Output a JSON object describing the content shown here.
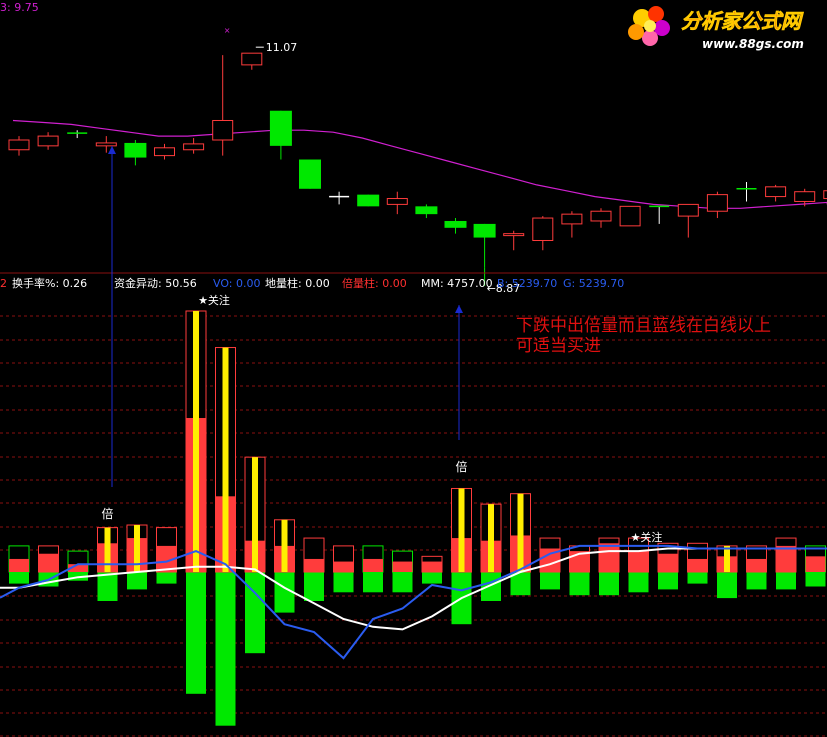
{
  "colors": {
    "background": "#000000",
    "up": "#ff3c3c",
    "down": "#00e800",
    "ma_line": "#d020d0",
    "grid": "#8a1010",
    "blue_line": "#2a5cf0",
    "white_line": "#ffffff",
    "highlight": "#ffee00",
    "annotation": "#e01010",
    "arrow": "#1a2ad0"
  },
  "header": {
    "price_top_label": "3: 9.75"
  },
  "logo": {
    "brand_cn": "分析家公式网",
    "url": "www.88gs.com"
  },
  "indicator_bar": {
    "index_label": "2",
    "items": [
      {
        "label": "换手率%:",
        "value": "0.26",
        "color": "#ffffff"
      },
      {
        "label": "资金异动:",
        "value": "50.56",
        "color": "#ffffff"
      },
      {
        "label": "VO:",
        "value": "0.00",
        "color": "#2a5cf0"
      },
      {
        "label": "地量柱:",
        "value": "0.00",
        "color": "#ffffff"
      },
      {
        "label": "倍量柱:",
        "value": "0.00",
        "color": "#ff3030"
      },
      {
        "label": "MM:",
        "value": "4757.00",
        "color": "#ffffff"
      },
      {
        "label": "B:",
        "value": "5239.70",
        "color": "#2a5cf0"
      },
      {
        "label": "G:",
        "value": "5239.70",
        "color": "#2a5cf0"
      }
    ]
  },
  "annotation": {
    "line1": "下跌中出倍量而且蓝线在白线以上",
    "line2": "可适当买进"
  },
  "markers": {
    "double_volume": "倍",
    "attention": "关注",
    "star": "★"
  },
  "chart_data": [
    {
      "type": "candlestick",
      "title": "",
      "annotations": [
        {
          "text": "11.07",
          "type": "high"
        },
        {
          "text": "8.87",
          "type": "low"
        }
      ],
      "ylim": [
        8.6,
        11.3
      ],
      "candles": [
        {
          "o": 10.08,
          "c": 10.18,
          "h": 10.22,
          "l": 10.02
        },
        {
          "o": 10.12,
          "c": 10.22,
          "h": 10.26,
          "l": 10.08
        },
        {
          "o": 10.25,
          "c": 10.25,
          "h": 10.28,
          "l": 10.2
        },
        {
          "o": 10.12,
          "c": 10.15,
          "h": 10.22,
          "l": 10.05
        },
        {
          "o": 10.15,
          "c": 10.0,
          "h": 10.18,
          "l": 9.92
        },
        {
          "o": 10.02,
          "c": 10.1,
          "h": 10.14,
          "l": 9.98
        },
        {
          "o": 10.08,
          "c": 10.14,
          "h": 10.2,
          "l": 10.04
        },
        {
          "o": 10.18,
          "c": 10.38,
          "h": 11.05,
          "l": 10.02
        },
        {
          "o": 10.95,
          "c": 11.07,
          "h": 11.07,
          "l": 10.9
        },
        {
          "o": 10.48,
          "c": 10.12,
          "h": 10.48,
          "l": 9.98
        },
        {
          "o": 9.98,
          "c": 9.68,
          "h": 9.98,
          "l": 9.68
        },
        {
          "o": 9.6,
          "c": 9.6,
          "h": 9.65,
          "l": 9.52
        },
        {
          "o": 9.62,
          "c": 9.5,
          "h": 9.62,
          "l": 9.5
        },
        {
          "o": 9.52,
          "c": 9.58,
          "h": 9.65,
          "l": 9.42
        },
        {
          "o": 9.5,
          "c": 9.42,
          "h": 9.52,
          "l": 9.38
        },
        {
          "o": 9.35,
          "c": 9.28,
          "h": 9.38,
          "l": 9.22
        },
        {
          "o": 9.32,
          "c": 9.18,
          "h": 9.32,
          "l": 8.87
        },
        {
          "o": 9.2,
          "c": 9.22,
          "h": 9.25,
          "l": 9.05
        },
        {
          "o": 9.15,
          "c": 9.38,
          "h": 9.4,
          "l": 9.05
        },
        {
          "o": 9.32,
          "c": 9.42,
          "h": 9.45,
          "l": 9.18
        },
        {
          "o": 9.35,
          "c": 9.45,
          "h": 9.48,
          "l": 9.28
        },
        {
          "o": 9.3,
          "c": 9.5,
          "h": 9.5,
          "l": 9.3
        },
        {
          "o": 9.5,
          "c": 9.5,
          "h": 9.5,
          "l": 9.32
        },
        {
          "o": 9.4,
          "c": 9.52,
          "h": 9.52,
          "l": 9.18
        },
        {
          "o": 9.45,
          "c": 9.62,
          "h": 9.65,
          "l": 9.38
        },
        {
          "o": 9.68,
          "c": 9.68,
          "h": 9.75,
          "l": 9.55
        },
        {
          "o": 9.6,
          "c": 9.7,
          "h": 9.72,
          "l": 9.55
        },
        {
          "o": 9.55,
          "c": 9.65,
          "h": 9.68,
          "l": 9.5
        },
        {
          "o": 9.58,
          "c": 9.66,
          "h": 9.7,
          "l": 9.55
        }
      ],
      "ma": [
        10.38,
        10.36,
        10.34,
        10.3,
        10.26,
        10.22,
        10.22,
        10.24,
        10.26,
        10.28,
        10.28,
        10.26,
        10.2,
        10.12,
        10.04,
        9.96,
        9.88,
        9.8,
        9.72,
        9.66,
        9.6,
        9.56,
        9.52,
        9.5,
        9.48,
        9.48,
        9.5,
        9.52,
        9.54
      ]
    },
    {
      "type": "bar",
      "title": "",
      "ylim": [
        -1,
        1
      ],
      "up_bars": [
        0.1,
        0.1,
        0.08,
        0.17,
        0.18,
        0.17,
        1.0,
        0.86,
        0.44,
        0.2,
        0.13,
        0.1,
        0.1,
        0.08,
        0.06,
        0.32,
        0.26,
        0.3,
        0.13,
        0.1,
        0.13,
        0.13,
        0.11,
        0.11,
        0.1,
        0.1,
        0.13,
        0.1,
        0.1,
        0.1
      ],
      "red_fill": [
        0.05,
        0.07,
        0.03,
        0.11,
        0.13,
        0.1,
        0.59,
        0.29,
        0.12,
        0.1,
        0.05,
        0.04,
        0.05,
        0.04,
        0.04,
        0.13,
        0.12,
        0.14,
        0.09,
        0.08,
        0.11,
        0.08,
        0.07,
        0.05,
        0.06,
        0.05,
        0.1,
        0.06,
        0.07,
        0.05
      ],
      "yellow_stripe": [
        false,
        false,
        false,
        true,
        true,
        false,
        true,
        true,
        true,
        true,
        false,
        false,
        false,
        false,
        false,
        true,
        true,
        true,
        false,
        false,
        false,
        false,
        false,
        false,
        true,
        false,
        false,
        false,
        false,
        false
      ],
      "down_bars": [
        -0.04,
        -0.05,
        -0.03,
        -0.1,
        -0.06,
        -0.04,
        -0.42,
        -0.53,
        -0.28,
        -0.14,
        -0.1,
        -0.07,
        -0.07,
        -0.07,
        -0.04,
        -0.18,
        -0.1,
        -0.08,
        -0.06,
        -0.08,
        -0.08,
        -0.07,
        -0.06,
        -0.04,
        -0.09,
        -0.06,
        -0.06,
        -0.05,
        -0.06,
        -0.06
      ],
      "blue_line": [
        -0.06,
        -0.03,
        0.03,
        0.03,
        0.03,
        0.04,
        0.08,
        0.03,
        -0.08,
        -0.2,
        -0.23,
        -0.33,
        -0.18,
        -0.14,
        -0.05,
        -0.07,
        -0.04,
        0.01,
        0.07,
        0.1,
        0.1,
        0.1,
        0.1,
        0.09,
        0.09,
        0.09,
        0.09,
        0.09,
        0.09,
        0.09
      ],
      "white_line": [
        -0.06,
        -0.04,
        -0.02,
        -0.01,
        0.0,
        0.01,
        0.02,
        0.02,
        0.01,
        -0.06,
        -0.12,
        -0.18,
        -0.21,
        -0.22,
        -0.17,
        -0.1,
        -0.05,
        0.0,
        0.03,
        0.07,
        0.08,
        0.08,
        0.09,
        0.09,
        0.09,
        0.09,
        0.09,
        0.09,
        0.09,
        0.09
      ]
    }
  ]
}
